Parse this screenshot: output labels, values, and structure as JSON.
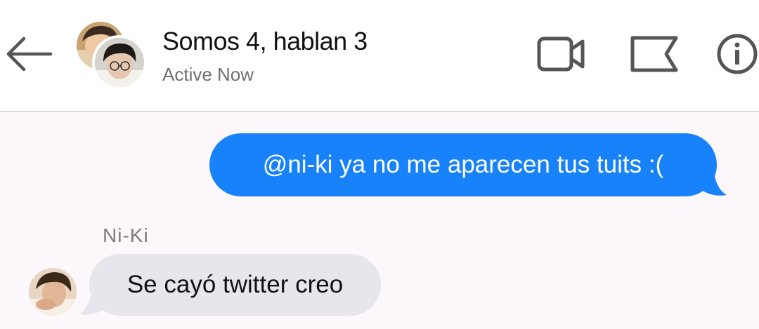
{
  "header": {
    "title": "Somos 4, hablan 3",
    "status": "Active Now",
    "icons": {
      "back": "arrow-left-icon",
      "video": "video-camera-icon",
      "flag": "flag-icon",
      "info": "info-icon"
    }
  },
  "messages": [
    {
      "direction": "outgoing",
      "text": "@ni-ki ya no me aparecen tus tuits :("
    },
    {
      "direction": "incoming",
      "sender": "Ni-Ki",
      "text": "Se cayó twitter creo"
    }
  ],
  "colors": {
    "outgoing_bubble": "#1782fa",
    "incoming_bubble": "#e7e6ec",
    "chat_background": "#fbf7fb",
    "header_background": "#ffffff",
    "icon_stroke": "#555555"
  }
}
